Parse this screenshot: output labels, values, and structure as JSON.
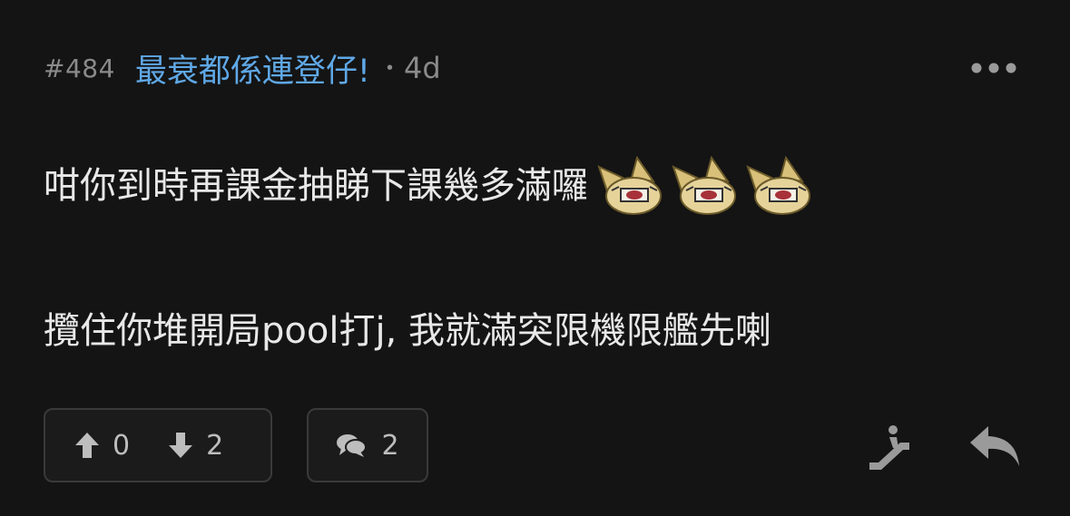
{
  "post": {
    "number": "#484",
    "username": "最衰都係連登仔!",
    "separator": "•",
    "time": "4d",
    "lines": [
      "咁你到時再課金抽睇下課幾多滿囉",
      "攬住你堆開局pool打j, 我就滿突限機限艦先喇"
    ],
    "emojis": [
      "cat-emoji",
      "cat-emoji",
      "cat-emoji"
    ]
  },
  "actions": {
    "upvote_count": "0",
    "downvote_count": "2",
    "reply_count": "2"
  },
  "icons": {
    "more": "more-dots-icon",
    "upvote": "arrow-up-icon",
    "downvote": "arrow-down-icon",
    "comments": "comments-icon",
    "escalator": "escalator-icon",
    "reply": "reply-arrow-icon"
  },
  "colors": {
    "background": "#141414",
    "username": "#5fa8e6",
    "muted": "#8a8a8a",
    "text": "#e8e8e8",
    "border": "#3a3a3a"
  }
}
